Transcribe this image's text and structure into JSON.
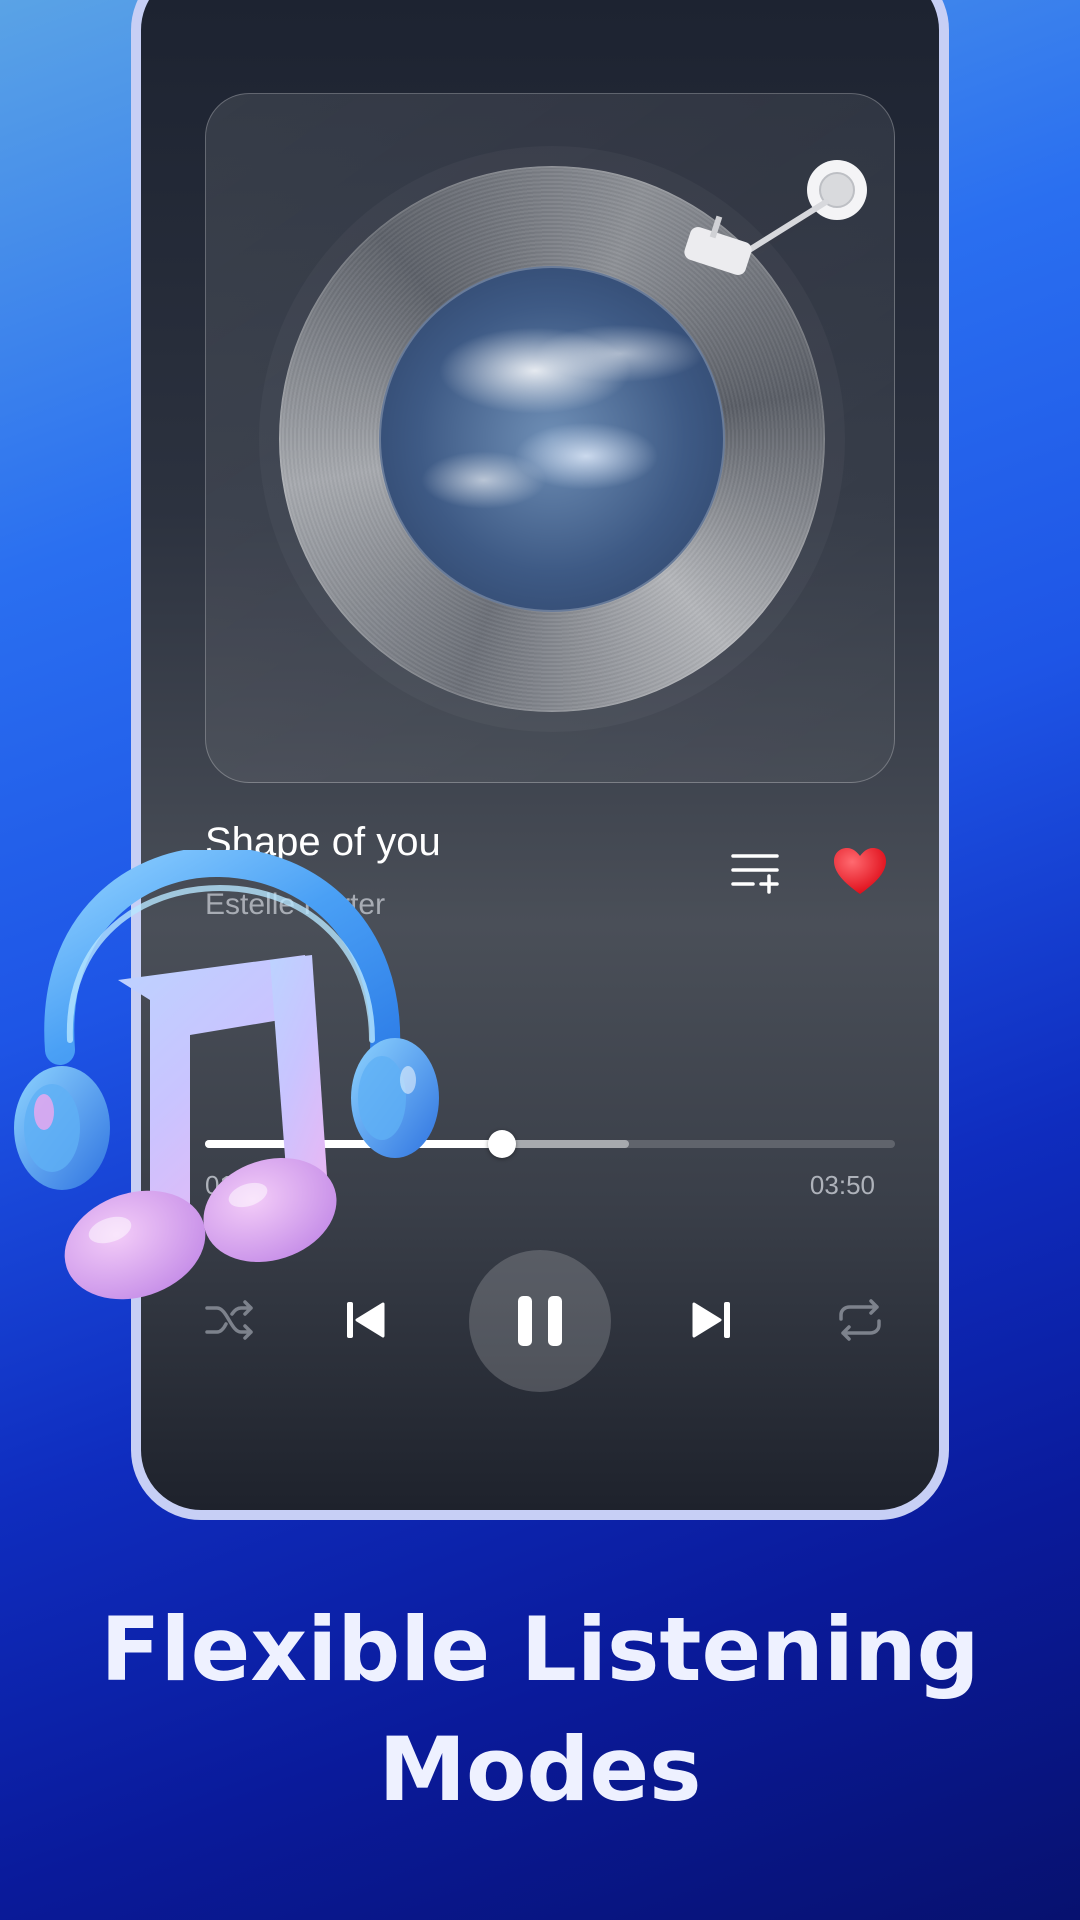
{
  "player": {
    "song_title": "Shape of you",
    "artist": "Estelle Porter",
    "time_elapsed": "01:12",
    "time_total": "03:50",
    "progress_fraction": 0.43,
    "buffer_fraction": 0.615,
    "liked": true
  },
  "controls": {
    "shuffle_icon": "shuffle-icon",
    "prev_icon": "skip-previous-icon",
    "play_icon": "pause-icon",
    "next_icon": "skip-next-icon",
    "repeat_icon": "repeat-icon",
    "queue_icon": "add-to-queue-icon",
    "heart_icon": "heart-icon"
  },
  "colors": {
    "heart": "#f0232f",
    "accent": "#ffffff",
    "frame": "#c7cff5"
  },
  "headline": {
    "line1": "Flexible Listening",
    "line2": "Modes"
  }
}
